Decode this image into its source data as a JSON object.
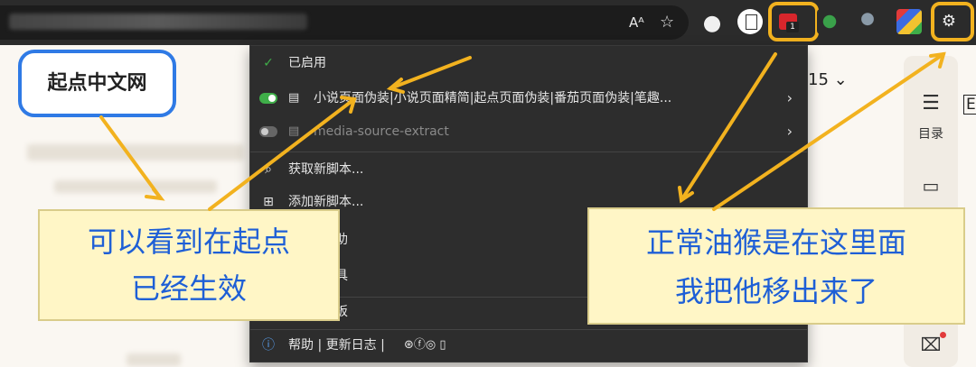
{
  "toolbar": {
    "read_aloud_icon": "Aᴬ",
    "favorite_icon": "☆",
    "badge_count": "1"
  },
  "page": {
    "date_suffix": "15 ⌄",
    "sidebar": {
      "toc_label": "目录",
      "toc_icon": "☰",
      "book_icon": "🕮",
      "e_letter": "E"
    }
  },
  "menu": {
    "enabled_label": "已启用",
    "scripts": [
      {
        "name": "小说页面伪装|小说页面精简|起点页面伪装|番茄页面伪装|笔趣...",
        "enabled": true
      },
      {
        "name": "media-source-extract",
        "enabled": false
      }
    ],
    "get_new": "获取新脚本...",
    "add_new": "添加新脚本...",
    "partial_items": [
      "助",
      "具",
      "板"
    ],
    "footer": "帮助 | 更新日志 |"
  },
  "annotations": {
    "site_label": "起点中文网",
    "note_left_line1": "可以看到在起点",
    "note_left_line2": "已经生效",
    "note_right_line1": "正常油猴是在这里面",
    "note_right_line2": "我把他移出来了"
  },
  "colors": {
    "highlight": "#f2b21f",
    "note_text": "#1e5fd6",
    "note_bg": "#fff6c6",
    "label_border": "#2f7ae5",
    "toggle_on": "#3fae49"
  }
}
